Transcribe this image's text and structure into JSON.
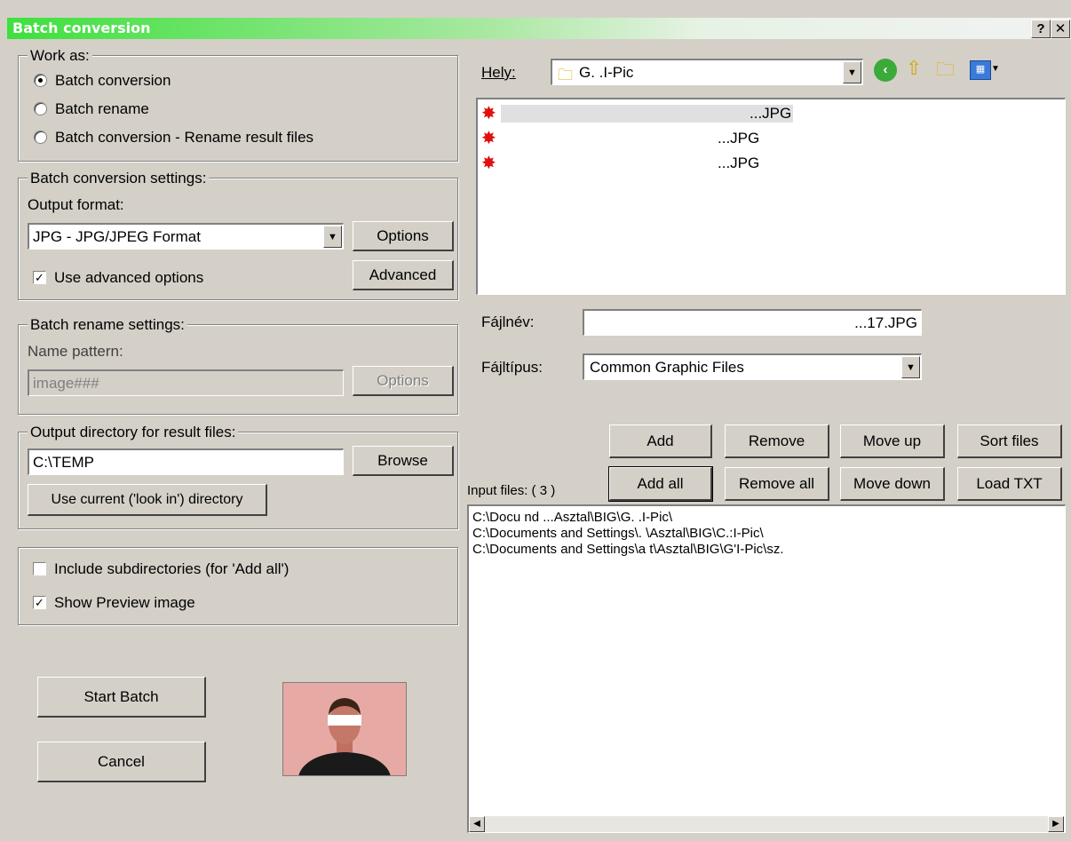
{
  "window": {
    "title": "Batch conversion",
    "help_label": "?",
    "close_label": "✕"
  },
  "work_as": {
    "legend": "Work as:",
    "options": [
      "Batch conversion",
      "Batch rename",
      "Batch conversion - Rename result files"
    ],
    "selected": 0
  },
  "conversion": {
    "legend": "Batch conversion settings:",
    "output_format_label": "Output format:",
    "output_format_value": "JPG - JPG/JPEG Format",
    "options_button": "Options",
    "advanced_checkbox": "Use advanced options",
    "advanced_checked": true,
    "advanced_button": "Advanced"
  },
  "rename": {
    "legend": "Batch rename settings:",
    "name_pattern_label": "Name pattern:",
    "name_pattern_value": "image###",
    "options_button": "Options"
  },
  "output_dir": {
    "legend": "Output directory for result files:",
    "value": "C:\\TEMP",
    "browse_button": "Browse",
    "use_current_button": "Use current ('look in') directory"
  },
  "misc": {
    "include_subdirs": "Include subdirectories (for 'Add all')",
    "include_subdirs_checked": false,
    "show_preview": "Show Preview image",
    "show_preview_checked": true
  },
  "actions": {
    "start": "Start Batch",
    "cancel": "Cancel"
  },
  "browser": {
    "location_label": "Hely:",
    "location_value": "G. .I-Pic",
    "files": [
      "...JPG",
      "...JPG",
      "...JPG"
    ],
    "filename_label": "Fájlnév:",
    "filename_value": "...17.JPG",
    "filetype_label": "Fájltípus:",
    "filetype_value": "Common Graphic Files"
  },
  "list_buttons": {
    "add": "Add",
    "remove": "Remove",
    "move_up": "Move up",
    "sort_files": "Sort files",
    "add_all": "Add all",
    "remove_all": "Remove all",
    "move_down": "Move down",
    "load_txt": "Load TXT"
  },
  "input_files": {
    "label": "Input files: ( 3 )",
    "paths": [
      "C:\\Docu     nd   ...Asztal\\BIG\\G. .I-Pic\\",
      "C:\\Documents and Settings\\.     \\Asztal\\BIG\\C.:I-Pic\\",
      "C:\\Documents and Settings\\a     t\\Asztal\\BIG\\G'I-Pic\\sz."
    ]
  },
  "colors": {
    "title_green": "#3ee03e",
    "face": "#d4d0c8",
    "folder": "#f0d060",
    "red_icon": "#e01010"
  }
}
